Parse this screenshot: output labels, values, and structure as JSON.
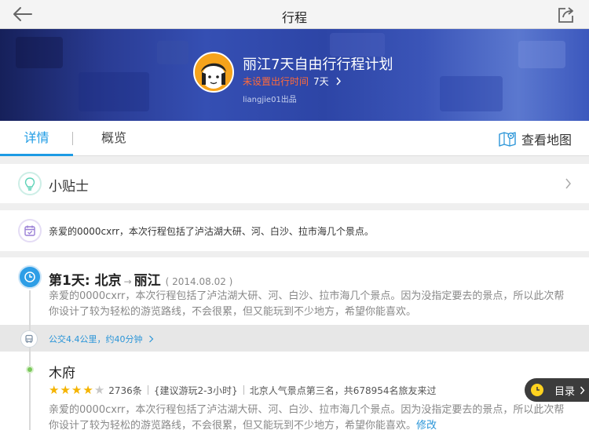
{
  "nav": {
    "title": "行程"
  },
  "hero": {
    "title": "丽江7天自由行行程计划",
    "unset_time": "未设置出行时间",
    "days": "7天",
    "author": "liangjie01出品"
  },
  "tabs": {
    "detail": "详情",
    "overview": "概览",
    "map": "查看地图"
  },
  "tips": {
    "label": "小贴士"
  },
  "intro": {
    "text": "亲爱的0000cxrr，本次行程包括了泸沽湖大研、河、白沙、拉市海几个景点。"
  },
  "day1": {
    "title": "第1天",
    "colon": ":",
    "from": "北京",
    "arrow": "→",
    "to": "丽江",
    "date": "( 2014.08.02 )",
    "desc": "亲爱的0000cxrr，本次行程包括了泸沽湖大研、河、白沙、拉市海几个景点。因为没指定要去的景点，所以此次帮你设计了较为轻松的游览路线，不会很累，但又能玩到不少地方，希望你能喜欢。"
  },
  "transport": {
    "text": "公交4.4公里，约40分钟"
  },
  "poi": {
    "name": "木府",
    "rating": 4,
    "rating_max": 5,
    "count": "2736条",
    "suggest": "{建议游玩2-3小时}",
    "rank": "北京人气景点第三名，共678954名旅友来过",
    "desc": "亲爱的0000cxrr，本次行程包括了泸沽湖大研、河、白沙、拉市海几个景点。因为没指定要去的景点，所以此次帮你设计了较为轻松的游览路线，不会很累，但又能玩到不少地方，希望你能喜欢。",
    "edit": "修改"
  },
  "toc": {
    "label": "目录"
  },
  "colors": {
    "accent": "#1d9be4",
    "warn": "#ff6a3a",
    "star": "#f5b400",
    "tips_icon": "#5fd3b8",
    "intro_icon": "#9a7fd6",
    "clock_icon": "#2e9ee6"
  },
  "icons": [
    "back-arrow-icon",
    "share-icon",
    "map-pin-icon",
    "lightbulb-icon",
    "calendar-icon",
    "clock-icon",
    "bus-icon",
    "chevron-right-icon"
  ]
}
